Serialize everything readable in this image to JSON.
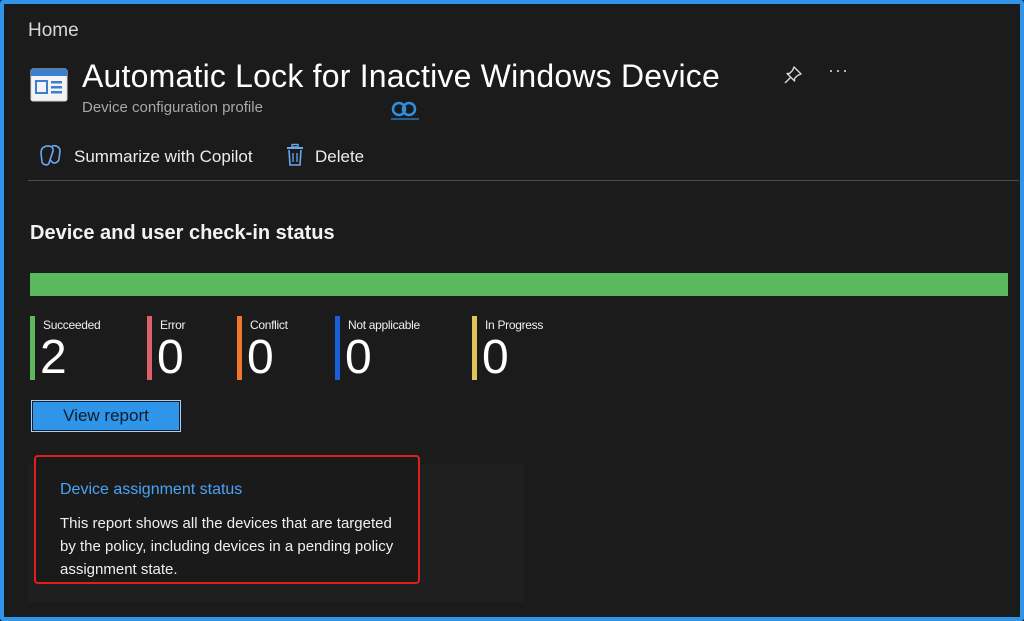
{
  "breadcrumb": "Home",
  "header": {
    "title": "Automatic Lock for Inactive Windows Device",
    "subtitle": "Device configuration profile",
    "title_icon": "profile-icon",
    "pin_icon": "pin-icon",
    "more_label": "···"
  },
  "toolbar": {
    "copilot_label": "Summarize with Copilot",
    "delete_label": "Delete"
  },
  "checkin": {
    "title": "Device and user check-in status",
    "succeeded_fraction": 1.0,
    "stats": [
      {
        "label": "Succeeded",
        "value": "2",
        "color": "#5cb85c"
      },
      {
        "label": "Error",
        "value": "0",
        "color": "#d9626b"
      },
      {
        "label": "Conflict",
        "value": "0",
        "color": "#f0782a"
      },
      {
        "label": "Not applicable",
        "value": "0",
        "color": "#1a5fd8"
      },
      {
        "label": "In Progress",
        "value": "0",
        "color": "#e0c45a"
      }
    ],
    "view_report_label": "View report"
  },
  "assignment_card": {
    "link": "Device assignment status",
    "description": "This report shows all the devices that are targeted by the policy, including devices in a pending policy assignment state."
  },
  "colors": {
    "accent": "#2f95e8",
    "highlight": "#e01e1e",
    "link": "#4aa3f5"
  }
}
